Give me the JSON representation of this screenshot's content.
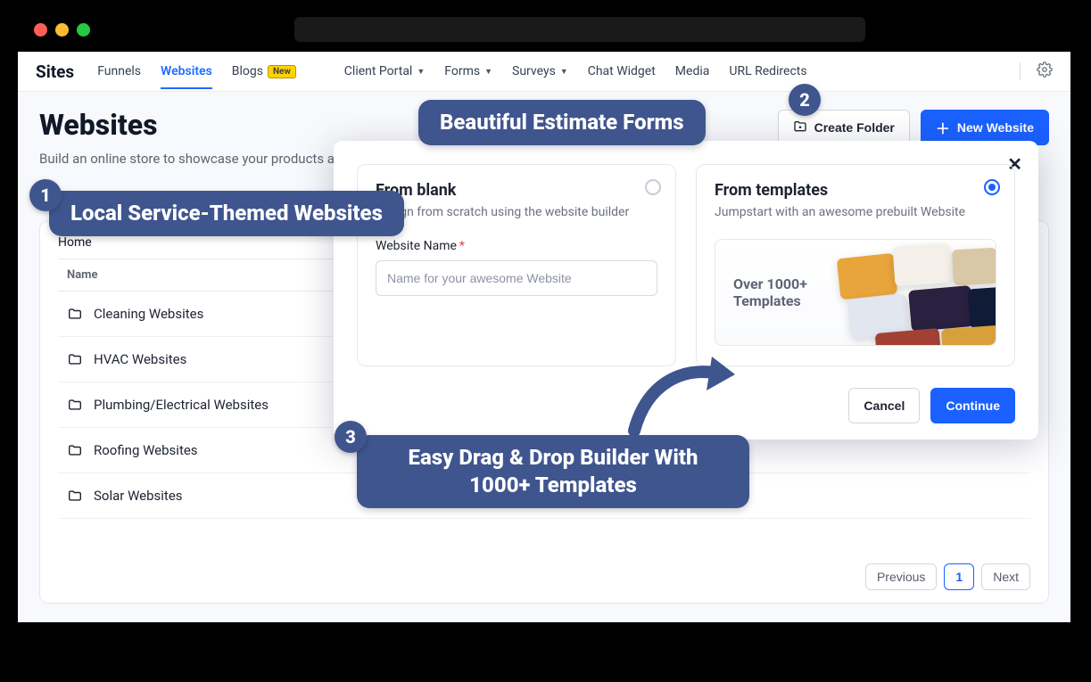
{
  "brand": "Sites",
  "nav": {
    "funnels": "Funnels",
    "websites": "Websites",
    "blogs": "Blogs",
    "blogs_badge": "New",
    "client_portal": "Client Portal",
    "forms": "Forms",
    "surveys": "Surveys",
    "chat_widget": "Chat Widget",
    "media": "Media",
    "url_redirects": "URL Redirects"
  },
  "page": {
    "title": "Websites",
    "subtitle": "Build an online store to showcase your products and sell across the globe"
  },
  "actions": {
    "create_folder": "Create Folder",
    "new_website": "New Website"
  },
  "breadcrumb": "Home",
  "list": {
    "header_name": "Name",
    "rows": [
      {
        "name": "Cleaning Websites"
      },
      {
        "name": "HVAC Websites"
      },
      {
        "name": "Plumbing/Electrical Websites"
      },
      {
        "name": "Roofing Websites"
      },
      {
        "name": "Solar Websites"
      }
    ]
  },
  "pagination": {
    "previous": "Previous",
    "page": "1",
    "next": "Next"
  },
  "modal": {
    "blank_title": "From blank",
    "blank_sub": "Design from scratch using the website builder",
    "templates_title": "From templates",
    "templates_sub": "Jumpstart with an awesome prebuilt Website",
    "field_label": "Website Name",
    "placeholder": "Name for your awesome Website",
    "tpl_count_text": "Over 1000+ Templates",
    "cancel": "Cancel",
    "continue": "Continue"
  },
  "annotations": {
    "a1": "Local Service-Themed Websites",
    "a2": "Beautiful Estimate Forms",
    "a3": "Easy Drag & Drop Builder With 1000+ Templates"
  }
}
